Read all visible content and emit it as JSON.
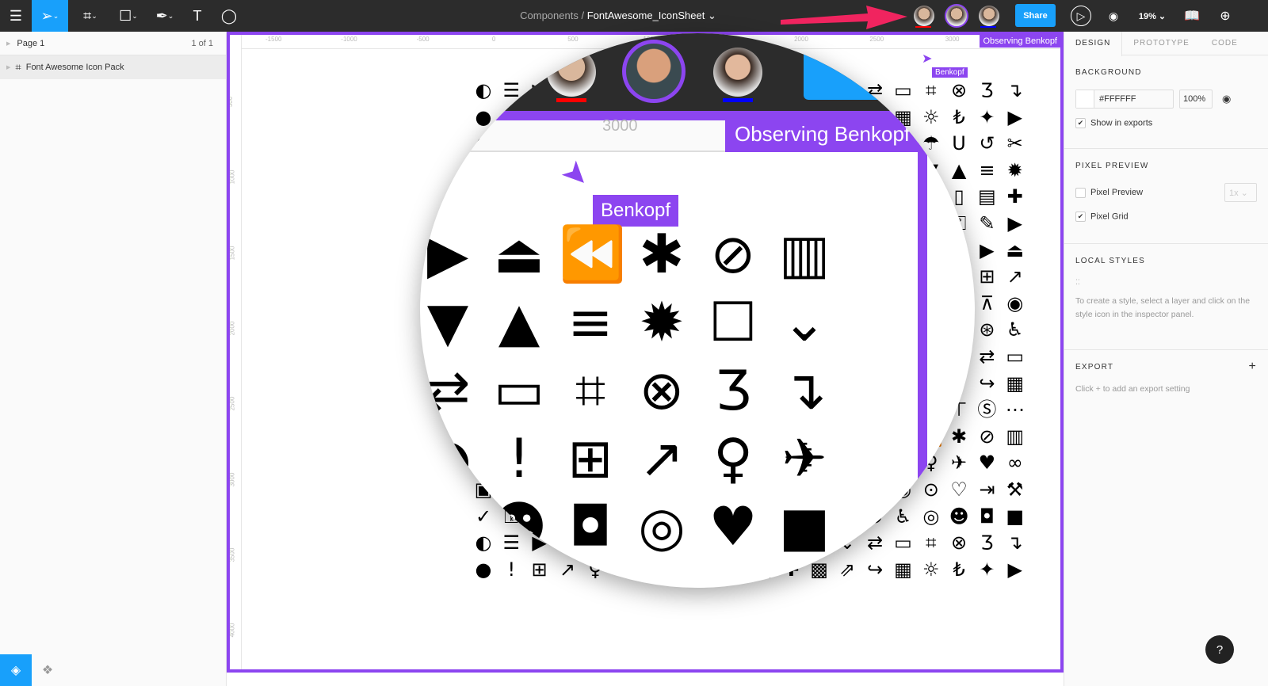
{
  "toolbar": {
    "breadcrumb_parent": "Components",
    "separator": "/",
    "file_name": "FontAwesome_IconSheet ⌄",
    "share_label": "Share",
    "zoom": "19% ⌄",
    "accent": "#18a0fb"
  },
  "collaborators": [
    {
      "name": "user-1",
      "underline": "#ff0000"
    },
    {
      "name": "Benkopf",
      "underline": "#8c45f0"
    },
    {
      "name": "user-3",
      "underline": "#0000ff"
    }
  ],
  "layers": {
    "page": "Page 1",
    "page_count": "1 of 1",
    "items": [
      {
        "label": "Font Awesome Icon Pack"
      }
    ]
  },
  "canvas": {
    "observing_label": "Observing Benkopf",
    "cursor_label": "Benkopf",
    "observe_color": "#8c45f0",
    "hruler": [
      "-1500",
      "-1000",
      "-500",
      "0",
      "500",
      "1000",
      "1500",
      "2000",
      "2500",
      "3000"
    ],
    "vruler": [
      "500",
      "1000",
      "1500",
      "2000",
      "2500",
      "3000",
      "3500",
      "4000"
    ],
    "magnified_ruler": "3000"
  },
  "inspector": {
    "tabs": [
      "DESIGN",
      "PROTOTYPE",
      "CODE"
    ],
    "background": {
      "title": "BACKGROUND",
      "color": "#FFFFFF",
      "opacity": "100%",
      "show_in_exports": "Show in exports"
    },
    "pixel_preview": {
      "title": "PIXEL PREVIEW",
      "preview_label": "Pixel Preview",
      "scale": "1x",
      "grid_label": "Pixel Grid",
      "preview_checked": false,
      "grid_checked": true
    },
    "local_styles": {
      "title": "LOCAL STYLES",
      "hint": "To create a style, select a layer and click on the style icon in the inspector panel."
    },
    "export": {
      "title": "EXPORT",
      "hint": "Click + to add an export setting"
    }
  },
  "help": "?",
  "icons": [
    "adjust",
    "bars",
    "caret-right",
    "caret-square-up",
    "backward",
    "asterisk",
    "ban",
    "bar-chart",
    "caret-down",
    "caret-up",
    "align-center",
    "certificate",
    "square-o",
    "chevron-down",
    "random",
    "credit-card",
    "crop",
    "times-circle",
    "css3",
    "level-down",
    "circle",
    "exclamation",
    "plus-square",
    "external-link",
    "female",
    "fighter-jet",
    "heart-circle",
    "link",
    "linkedin",
    "mobile",
    "money",
    "puzzle",
    "qrcode",
    "share-square",
    "share",
    "suitcase",
    "sun",
    "turkish-lira",
    "twitter",
    "youtube",
    "search-plus",
    "flag",
    "chevron-circle-up",
    "eye",
    "eye-slash",
    "heart-o",
    "indent",
    "gavel",
    "check-circle",
    "unlock",
    "wrench",
    "play",
    "signal",
    "sitemap",
    "skype",
    "ellipsis",
    "umbrella",
    "underline",
    "undo",
    "unlink",
    "lock-open",
    "warning",
    "weibo",
    "wheelchair",
    "github",
    "github-alt",
    "github-square",
    "stop"
  ]
}
